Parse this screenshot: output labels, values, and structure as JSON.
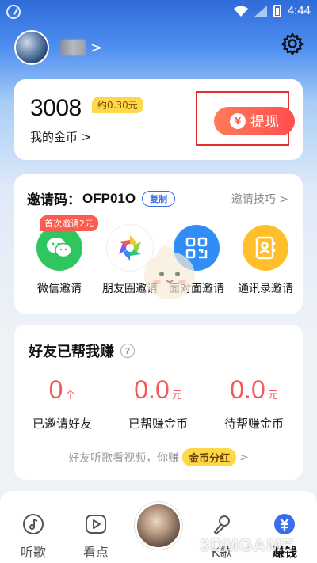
{
  "status_bar": {
    "time": "4:44"
  },
  "profile": {
    "chevron": ">"
  },
  "coins": {
    "amount": "3008",
    "approx_value": "约0.30元",
    "label": "我的金币 >",
    "withdraw_label": "提现",
    "withdraw_icon": "¥"
  },
  "invite": {
    "label": "邀请码：",
    "code": "OFP01O",
    "copy_label": "复制",
    "tips_label": "邀请技巧 >",
    "first_invite_badge": "首次邀请2元",
    "share_options": [
      {
        "label": "微信邀请",
        "icon": "wechat-icon",
        "color": "#2fc65f"
      },
      {
        "label": "朋友圈邀请",
        "icon": "moments-icon",
        "color": "#ffffff"
      },
      {
        "label": "面对面邀请",
        "icon": "qr-code-icon",
        "color": "#2f8df5"
      },
      {
        "label": "通讯录邀请",
        "icon": "contacts-icon",
        "color": "#ffbf2c"
      }
    ]
  },
  "friends": {
    "title": "好友已帮我赚",
    "help_icon": "?",
    "stats": [
      {
        "value": "0",
        "unit": "个",
        "label": "已邀请好友"
      },
      {
        "value": "0.0",
        "unit": "元",
        "label": "已帮赚金币"
      },
      {
        "value": "0.0",
        "unit": "元",
        "label": "待帮赚金币"
      }
    ],
    "promo_text": "好友听歌看视频，你赚",
    "promo_button": "金币分红",
    "promo_chevron": ">"
  },
  "tabbar": {
    "tabs": [
      {
        "label": "听歌",
        "icon": "music-note-icon",
        "active": false
      },
      {
        "label": "看点",
        "icon": "play-video-icon",
        "active": false
      },
      {
        "label": "K歌",
        "icon": "microphone-icon",
        "active": false
      },
      {
        "label": "赚钱",
        "icon": "yen-coin-icon",
        "active": true
      }
    ]
  },
  "watermark": "3DMGAME",
  "colors": {
    "accent_blue": "#3a6ee8",
    "withdraw_red": "#ff4e4e",
    "stat_red": "#f25a5a",
    "gold": "#ffd84a"
  }
}
